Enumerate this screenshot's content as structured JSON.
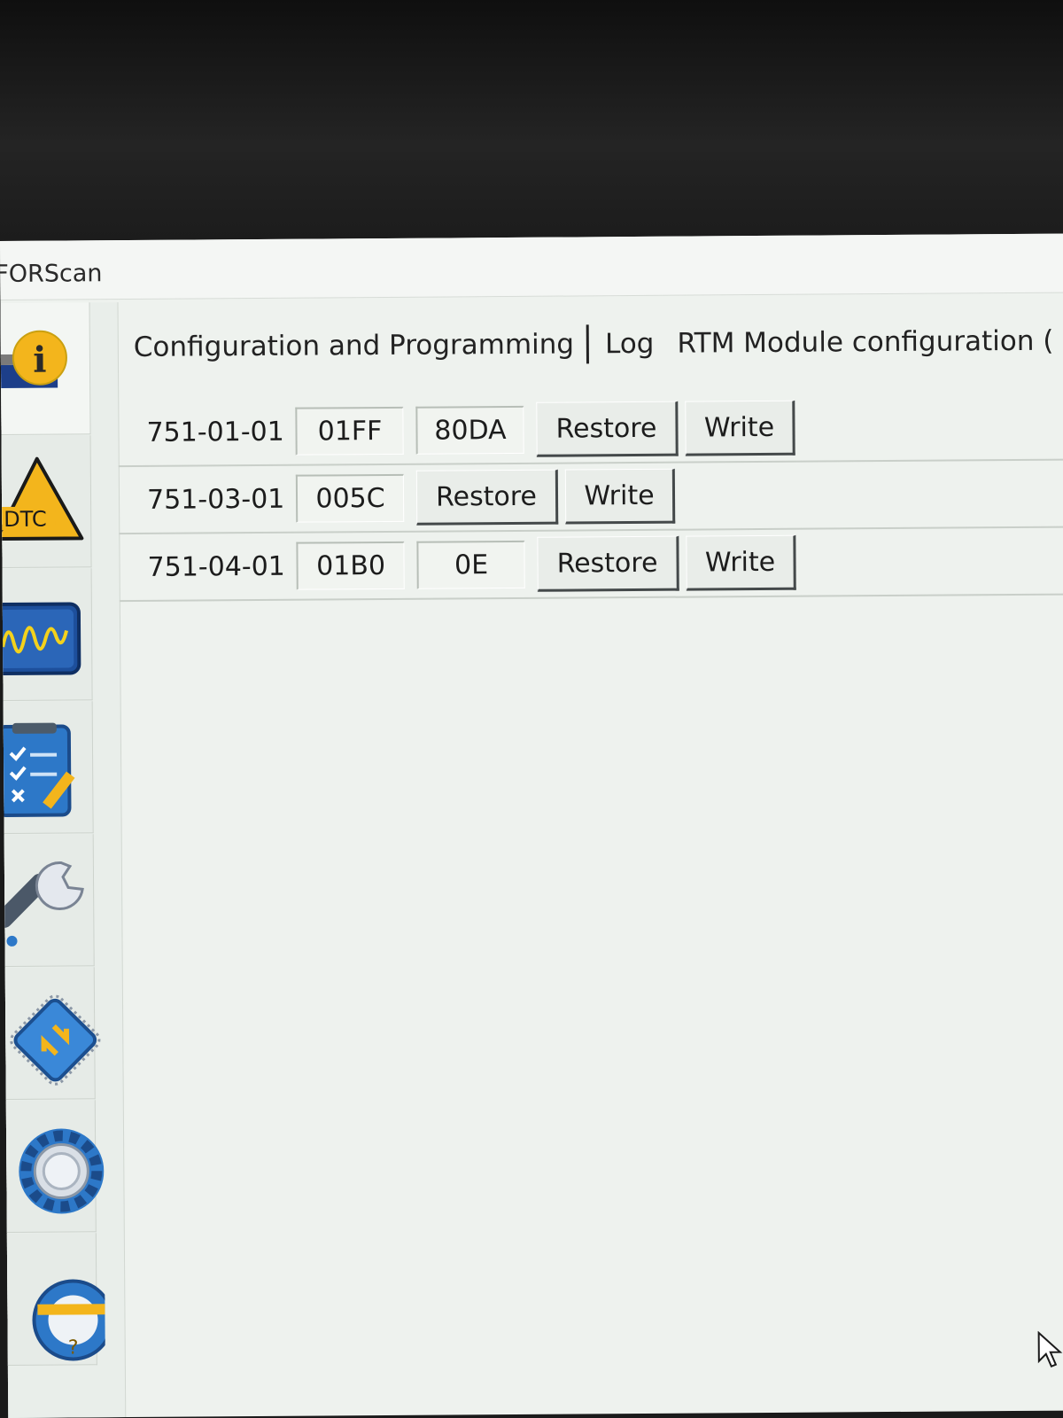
{
  "window": {
    "title": "FORScan"
  },
  "sidebar": {
    "items": [
      {
        "icon": "info-icon"
      },
      {
        "icon": "dtc-warning-icon",
        "label": "DTC"
      },
      {
        "icon": "oscilloscope-icon"
      },
      {
        "icon": "checklist-icon"
      },
      {
        "icon": "wrench-icon"
      },
      {
        "icon": "chip-icon"
      },
      {
        "icon": "gear-icon"
      },
      {
        "icon": "help-icon",
        "label": "?"
      }
    ]
  },
  "tabs": [
    {
      "label": "Configuration and Programming"
    },
    {
      "label": "Log"
    },
    {
      "label": "RTM Module configuration ("
    }
  ],
  "config_rows": [
    {
      "address": "751-01-01",
      "values": [
        "01FF",
        "80DA"
      ],
      "restore_label": "Restore",
      "write_label": "Write"
    },
    {
      "address": "751-03-01",
      "values": [
        "005C"
      ],
      "restore_label": "Restore",
      "write_label": "Write"
    },
    {
      "address": "751-04-01",
      "values": [
        "01B0",
        "0E"
      ],
      "restore_label": "Restore",
      "write_label": "Write"
    }
  ]
}
